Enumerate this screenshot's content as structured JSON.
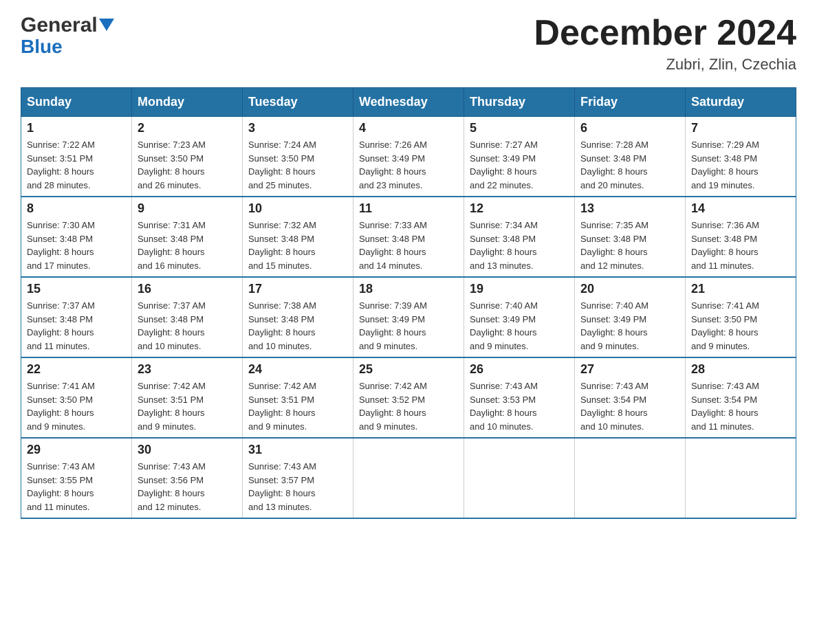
{
  "header": {
    "logo_line1": "General",
    "logo_line2": "Blue",
    "month_title": "December 2024",
    "location": "Zubri, Zlin, Czechia"
  },
  "weekdays": [
    "Sunday",
    "Monday",
    "Tuesday",
    "Wednesday",
    "Thursday",
    "Friday",
    "Saturday"
  ],
  "weeks": [
    [
      {
        "day": "1",
        "sunrise": "7:22 AM",
        "sunset": "3:51 PM",
        "daylight": "8 hours and 28 minutes."
      },
      {
        "day": "2",
        "sunrise": "7:23 AM",
        "sunset": "3:50 PM",
        "daylight": "8 hours and 26 minutes."
      },
      {
        "day": "3",
        "sunrise": "7:24 AM",
        "sunset": "3:50 PM",
        "daylight": "8 hours and 25 minutes."
      },
      {
        "day": "4",
        "sunrise": "7:26 AM",
        "sunset": "3:49 PM",
        "daylight": "8 hours and 23 minutes."
      },
      {
        "day": "5",
        "sunrise": "7:27 AM",
        "sunset": "3:49 PM",
        "daylight": "8 hours and 22 minutes."
      },
      {
        "day": "6",
        "sunrise": "7:28 AM",
        "sunset": "3:48 PM",
        "daylight": "8 hours and 20 minutes."
      },
      {
        "day": "7",
        "sunrise": "7:29 AM",
        "sunset": "3:48 PM",
        "daylight": "8 hours and 19 minutes."
      }
    ],
    [
      {
        "day": "8",
        "sunrise": "7:30 AM",
        "sunset": "3:48 PM",
        "daylight": "8 hours and 17 minutes."
      },
      {
        "day": "9",
        "sunrise": "7:31 AM",
        "sunset": "3:48 PM",
        "daylight": "8 hours and 16 minutes."
      },
      {
        "day": "10",
        "sunrise": "7:32 AM",
        "sunset": "3:48 PM",
        "daylight": "8 hours and 15 minutes."
      },
      {
        "day": "11",
        "sunrise": "7:33 AM",
        "sunset": "3:48 PM",
        "daylight": "8 hours and 14 minutes."
      },
      {
        "day": "12",
        "sunrise": "7:34 AM",
        "sunset": "3:48 PM",
        "daylight": "8 hours and 13 minutes."
      },
      {
        "day": "13",
        "sunrise": "7:35 AM",
        "sunset": "3:48 PM",
        "daylight": "8 hours and 12 minutes."
      },
      {
        "day": "14",
        "sunrise": "7:36 AM",
        "sunset": "3:48 PM",
        "daylight": "8 hours and 11 minutes."
      }
    ],
    [
      {
        "day": "15",
        "sunrise": "7:37 AM",
        "sunset": "3:48 PM",
        "daylight": "8 hours and 11 minutes."
      },
      {
        "day": "16",
        "sunrise": "7:37 AM",
        "sunset": "3:48 PM",
        "daylight": "8 hours and 10 minutes."
      },
      {
        "day": "17",
        "sunrise": "7:38 AM",
        "sunset": "3:48 PM",
        "daylight": "8 hours and 10 minutes."
      },
      {
        "day": "18",
        "sunrise": "7:39 AM",
        "sunset": "3:49 PM",
        "daylight": "8 hours and 9 minutes."
      },
      {
        "day": "19",
        "sunrise": "7:40 AM",
        "sunset": "3:49 PM",
        "daylight": "8 hours and 9 minutes."
      },
      {
        "day": "20",
        "sunrise": "7:40 AM",
        "sunset": "3:49 PM",
        "daylight": "8 hours and 9 minutes."
      },
      {
        "day": "21",
        "sunrise": "7:41 AM",
        "sunset": "3:50 PM",
        "daylight": "8 hours and 9 minutes."
      }
    ],
    [
      {
        "day": "22",
        "sunrise": "7:41 AM",
        "sunset": "3:50 PM",
        "daylight": "8 hours and 9 minutes."
      },
      {
        "day": "23",
        "sunrise": "7:42 AM",
        "sunset": "3:51 PM",
        "daylight": "8 hours and 9 minutes."
      },
      {
        "day": "24",
        "sunrise": "7:42 AM",
        "sunset": "3:51 PM",
        "daylight": "8 hours and 9 minutes."
      },
      {
        "day": "25",
        "sunrise": "7:42 AM",
        "sunset": "3:52 PM",
        "daylight": "8 hours and 9 minutes."
      },
      {
        "day": "26",
        "sunrise": "7:43 AM",
        "sunset": "3:53 PM",
        "daylight": "8 hours and 10 minutes."
      },
      {
        "day": "27",
        "sunrise": "7:43 AM",
        "sunset": "3:54 PM",
        "daylight": "8 hours and 10 minutes."
      },
      {
        "day": "28",
        "sunrise": "7:43 AM",
        "sunset": "3:54 PM",
        "daylight": "8 hours and 11 minutes."
      }
    ],
    [
      {
        "day": "29",
        "sunrise": "7:43 AM",
        "sunset": "3:55 PM",
        "daylight": "8 hours and 11 minutes."
      },
      {
        "day": "30",
        "sunrise": "7:43 AM",
        "sunset": "3:56 PM",
        "daylight": "8 hours and 12 minutes."
      },
      {
        "day": "31",
        "sunrise": "7:43 AM",
        "sunset": "3:57 PM",
        "daylight": "8 hours and 13 minutes."
      },
      null,
      null,
      null,
      null
    ]
  ],
  "labels": {
    "sunrise": "Sunrise:",
    "sunset": "Sunset:",
    "daylight": "Daylight:"
  }
}
